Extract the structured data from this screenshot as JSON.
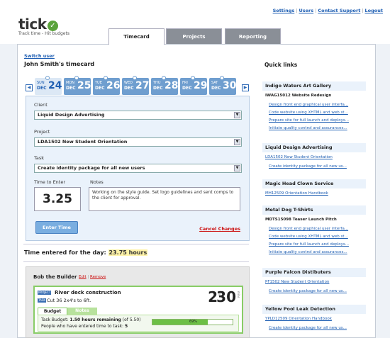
{
  "app": {
    "logo_text": "tick",
    "tagline": "Track time - Hit budgets"
  },
  "top_links": [
    "Settings",
    "Users",
    "Contact Support",
    "Logout"
  ],
  "tabs": [
    {
      "label": "Timecard",
      "active": true
    },
    {
      "label": "Projects",
      "active": false
    },
    {
      "label": "Reporting",
      "active": false
    }
  ],
  "timecard": {
    "switch_user": "Switch user",
    "title": "John Smith's timecard",
    "days": [
      {
        "dow": "SUN",
        "month": "DEC",
        "day": "24",
        "selected": true
      },
      {
        "dow": "MON",
        "month": "DEC",
        "day": "25",
        "selected": false
      },
      {
        "dow": "TUE",
        "month": "DEC",
        "day": "26",
        "selected": false
      },
      {
        "dow": "WED",
        "month": "DEC",
        "day": "27",
        "selected": false
      },
      {
        "dow": "THU",
        "month": "DEC",
        "day": "28",
        "selected": false
      },
      {
        "dow": "FRI",
        "month": "DEC",
        "day": "29",
        "selected": false
      },
      {
        "dow": "SAT",
        "month": "DEC",
        "day": "30",
        "selected": false
      }
    ],
    "form": {
      "client_label": "Client",
      "client_value": "Liquid Design Advertising",
      "project_label": "Project",
      "project_value": "LDA1502 New Student Orientation",
      "task_label": "Task",
      "task_value": "Create identity package for all new users",
      "time_label": "Time to Enter",
      "time_value": "3.25",
      "notes_label": "Notes",
      "notes_value": "Working on the style guide. Set logo guidelines and sent comps to the client for approval.",
      "enter_button": "Enter Time",
      "cancel_link": "Cancel Changes"
    },
    "total_prefix": "Time entered for the day:",
    "total_value": "23.75 hours",
    "entries": [
      {
        "user": "Bob the Builder",
        "edit": "Edit",
        "remove": "Remove",
        "project_tag": "PROJECT",
        "project": "River deck construction",
        "task_tag": "TASK",
        "task": "Cut 36 2x4's to 6ft.",
        "hours": "2",
        "hours_label": "hrs",
        "minutes": "30",
        "minutes_label": "mins",
        "tab_budget": "Budget",
        "tab_notes": "Notes",
        "budget_prefix": "Task Budget:",
        "budget_text": "1.50 hours remaining",
        "budget_suffix": "(of 5.50)",
        "people_prefix": "People who have entered time to task:",
        "people_count": "5",
        "progress_label": "69%",
        "progress": 0.69
      }
    ]
  },
  "quick_links": {
    "title": "Quick links",
    "groups": [
      {
        "client": "Indigo Waters Art Gallery",
        "projects": [
          {
            "name": "IWAG15012 Website Redesign",
            "link": false,
            "tasks": [
              "Design front end graphical user interfa...",
              "Code website using XHTML and web st...",
              "Prepare site for full launch and deploys...",
              "Initiate quality control and assurances..."
            ]
          }
        ]
      },
      {
        "client": "Liquid Design Advertising",
        "projects": [
          {
            "name": "LDA1502 New Student Orientation",
            "link": true,
            "tasks": [
              "Create identity package for all new us..."
            ]
          }
        ]
      },
      {
        "client": "Magic Head Clown Service",
        "projects": [
          {
            "name": "MH12509 Orientation Handbook",
            "link": true,
            "tasks": []
          }
        ]
      },
      {
        "client": "Metal Dog T-Shirts",
        "projects": [
          {
            "name": "MDTS15098 Teaser Launch Pitch",
            "link": false,
            "tasks": [
              "Design front end graphical user interfa...",
              "Code website using XHTML and web st...",
              "Prepare site for full launch and deploys...",
              "Initiate quality control and assurances..."
            ]
          }
        ]
      },
      {
        "client": "Purple Falcon Distibuters",
        "projects": [
          {
            "name": "PF1502 New Student Orientation",
            "link": true,
            "tasks": [
              "Create identity package for all new us..."
            ]
          }
        ]
      },
      {
        "client": "Yellow Pool Leak Detection",
        "projects": [
          {
            "name": "YPLD12509 Orientation Handbook",
            "link": true,
            "tasks": [
              "Create identity package for all new us..."
            ]
          }
        ]
      }
    ]
  },
  "colors": {
    "accent": "#1f5fb3",
    "day_bg": "#6f9ecf",
    "success": "#6cbf45",
    "danger": "#cc1111"
  }
}
